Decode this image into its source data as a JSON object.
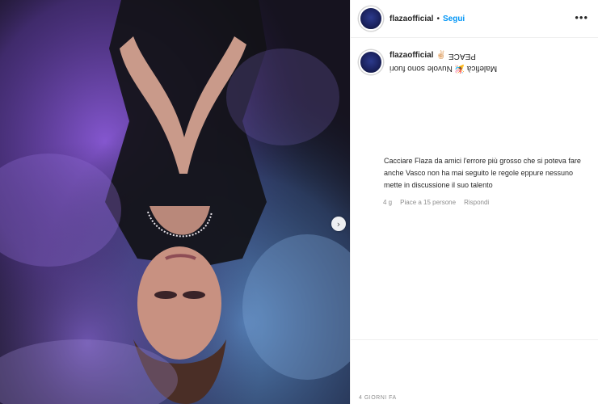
{
  "post": {
    "author": {
      "handle": "flazaofficial"
    },
    "header": {
      "separator": "•",
      "follow_label": "Segui",
      "more_glyph": "•••"
    },
    "caption": {
      "emoji": "✌🏻",
      "upside_down_text": "PEACE",
      "line2_upside_down": "Maleficà 🎉 Nuvole sono fuori"
    },
    "comment": {
      "text": "Cacciare Flaza da amici l'errore più grosso che si poteva fare anche Vasco non ha mai seguito le regole eppure nessuno mette in discussione il suo talento",
      "age": "4 g",
      "likes": "Piace a 15 persone",
      "reply_label": "Rispondi"
    },
    "timestamp": "4 GIORNI FA",
    "media": {
      "next_glyph": "›"
    }
  }
}
